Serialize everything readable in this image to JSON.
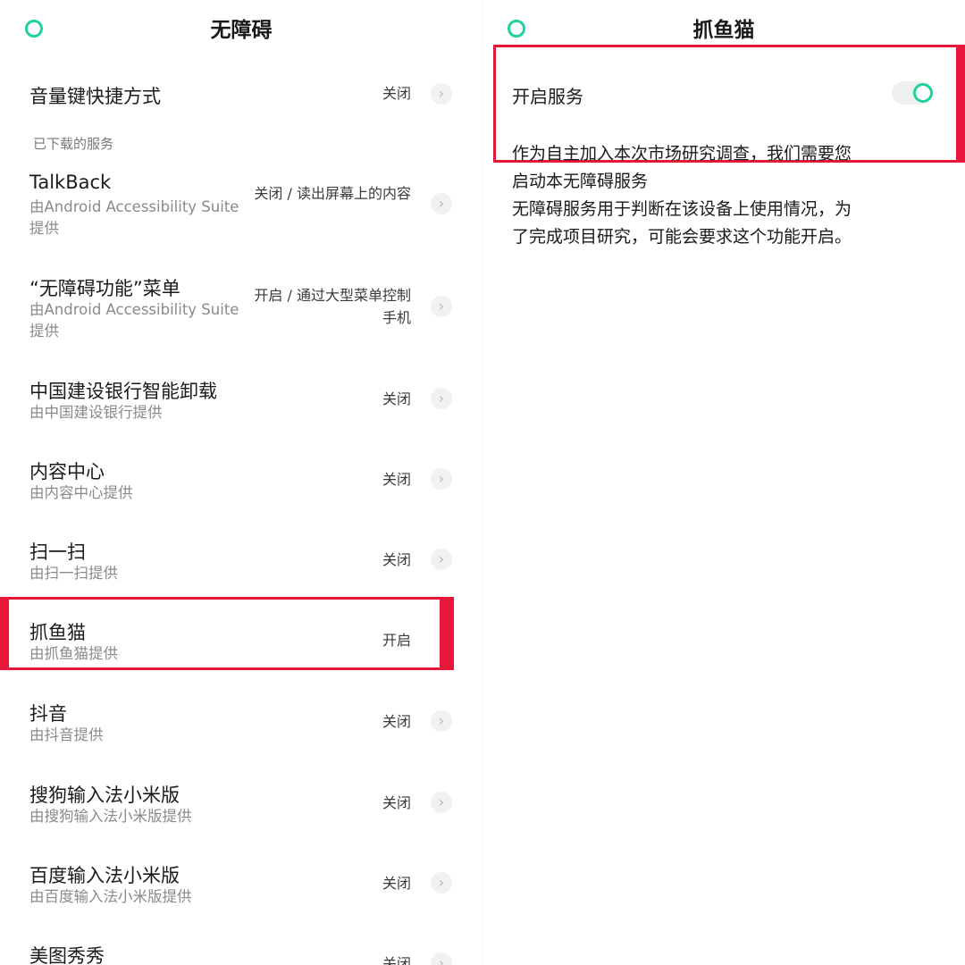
{
  "accent_color": "#1fd3a0",
  "highlight_color": "#e8173a",
  "left": {
    "back_icon": "circle-back-icon",
    "title": "无障碍",
    "volume_shortcut": {
      "label": "音量键快捷方式",
      "status": "关闭"
    },
    "section_label": "已下载的服务",
    "services": [
      {
        "title": "TalkBack",
        "subtitle": "由Android Accessibility Suite提供",
        "status": "关闭 / 读出屏幕上的内容"
      },
      {
        "title": "“无障碍功能”菜单",
        "subtitle": "由Android Accessibility Suite提供",
        "status": "开启 / 通过大型菜单控制手机"
      },
      {
        "title": "中国建设银行智能卸载",
        "subtitle": "由中国建设银行提供",
        "status": "关闭"
      },
      {
        "title": "内容中心",
        "subtitle": "由内容中心提供",
        "status": "关闭"
      },
      {
        "title": "扫一扫",
        "subtitle": "由扫一扫提供",
        "status": "关闭"
      },
      {
        "title": "抓鱼猫",
        "subtitle": "由抓鱼猫提供",
        "status": "开启"
      },
      {
        "title": "抖音",
        "subtitle": "由抖音提供",
        "status": "关闭"
      },
      {
        "title": "搜狗输入法小米版",
        "subtitle": "由搜狗输入法小米版提供",
        "status": "关闭"
      },
      {
        "title": "百度输入法小米版",
        "subtitle": "由百度输入法小米版提供",
        "status": "关闭"
      },
      {
        "title": "美图秀秀",
        "subtitle": "",
        "status": "关闭"
      }
    ]
  },
  "right": {
    "back_icon": "circle-back-icon",
    "title": "抓鱼猫",
    "service_toggle": {
      "label": "开启服务",
      "on": true
    },
    "description_lines": [
      "作为自主加入本次市场研究调查，我们需要您",
      "启动本无障碍服务",
      "无障碍服务用于判断在该设备上使用情况，为",
      "了完成项目研究，可能会要求这个功能开启。"
    ]
  }
}
